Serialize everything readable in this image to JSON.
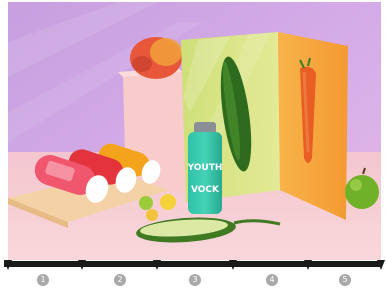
{
  "photo": {
    "bottle_text": {
      "line1": "YOUTH",
      "line2": "VOCK"
    },
    "colors": {
      "background_wall": "#c7a6e3",
      "table_top": "#f1c9cd",
      "green_panel": "#d7e080",
      "orange_panel": "#f7a43c",
      "pink_block": "#f6c3c3"
    }
  },
  "timeline": {
    "markers": [
      "1",
      "2",
      "3",
      "4",
      "5"
    ],
    "bar_color": "#1a1a1a",
    "marker_color": "#a9a9a9"
  }
}
